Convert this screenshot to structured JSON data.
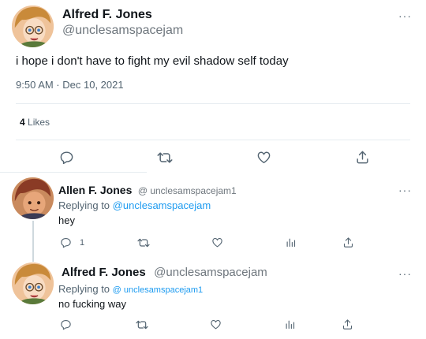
{
  "main_tweet": {
    "display_name": "Alfred F. Jones",
    "handle": "@unclesamspacejam",
    "text": "i hope i don't have to fight my evil shadow self today",
    "timestamp": "9:50 AM · Dec 10, 2021",
    "likes_count": "4",
    "likes_label": "Likes",
    "actions": [
      "reply-icon",
      "retweet-icon",
      "like-icon",
      "share-icon"
    ]
  },
  "reply_1": {
    "display_name": "Allen F. Jones",
    "handle": "@ unclesamspacejam1",
    "replying_to_label": "Replying to",
    "replying_to_handle": "@unclesamspacejam",
    "text": "hey",
    "reply_count": "1",
    "actions": [
      "reply-icon",
      "retweet-icon",
      "like-icon",
      "analytics-icon",
      "share-icon"
    ]
  },
  "reply_2": {
    "display_name": "Alfred F. Jones",
    "handle": "@unclesamspacejam",
    "replying_to_label": "Replying to",
    "replying_to_handle": "@ unclesamspacejam1",
    "text": "no fucking way",
    "actions": [
      "reply-icon",
      "retweet-icon",
      "like-icon",
      "analytics-icon",
      "share-icon"
    ]
  },
  "more_label": "···",
  "colors": {
    "link": "#1d9bf0",
    "muted": "#536471",
    "divider": "#e6ecf0"
  }
}
